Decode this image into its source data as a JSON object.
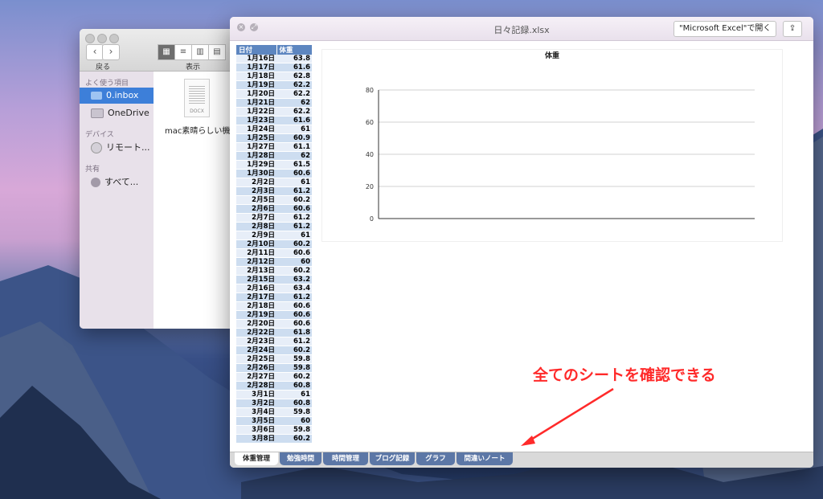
{
  "finder": {
    "back_label": "戻る",
    "view_label": "表示",
    "sections": {
      "favorites": "よく使う項目",
      "devices": "デバイス",
      "shared": "共有"
    },
    "sidebar_items": [
      "0.inbox",
      "OneDrive",
      "リモート...",
      "すべて..."
    ],
    "file": {
      "ext": "DOCX",
      "name": "mac素晴らしい機能"
    }
  },
  "quicklook": {
    "title": "日々記録.xlsx",
    "open_button": "\"Microsoft Excel\"で開く"
  },
  "sheet": {
    "headers": [
      "日付",
      "体重"
    ],
    "rows": [
      [
        "1月16日",
        "63.8"
      ],
      [
        "1月17日",
        "61.6"
      ],
      [
        "1月18日",
        "62.8"
      ],
      [
        "1月19日",
        "62.2"
      ],
      [
        "1月20日",
        "62.2"
      ],
      [
        "1月21日",
        "62"
      ],
      [
        "1月22日",
        "62.2"
      ],
      [
        "1月23日",
        "61.6"
      ],
      [
        "1月24日",
        "61"
      ],
      [
        "1月25日",
        "60.9"
      ],
      [
        "1月27日",
        "61.1"
      ],
      [
        "1月28日",
        "62"
      ],
      [
        "1月29日",
        "61.5"
      ],
      [
        "1月30日",
        "60.6"
      ],
      [
        "2月2日",
        "61"
      ],
      [
        "2月3日",
        "61.2"
      ],
      [
        "2月5日",
        "60.2"
      ],
      [
        "2月6日",
        "60.6"
      ],
      [
        "2月7日",
        "61.2"
      ],
      [
        "2月8日",
        "61.2"
      ],
      [
        "2月9日",
        "61"
      ],
      [
        "2月10日",
        "60.2"
      ],
      [
        "2月11日",
        "60.6"
      ],
      [
        "2月12日",
        "60"
      ],
      [
        "2月13日",
        "60.2"
      ],
      [
        "2月15日",
        "63.2"
      ],
      [
        "2月16日",
        "63.4"
      ],
      [
        "2月17日",
        "61.2"
      ],
      [
        "2月18日",
        "60.6"
      ],
      [
        "2月19日",
        "60.6"
      ],
      [
        "2月20日",
        "60.6"
      ],
      [
        "2月22日",
        "61.8"
      ],
      [
        "2月23日",
        "61.2"
      ],
      [
        "2月24日",
        "60.2"
      ],
      [
        "2月25日",
        "59.8"
      ],
      [
        "2月26日",
        "59.8"
      ],
      [
        "2月27日",
        "60.2"
      ],
      [
        "2月28日",
        "60.8"
      ],
      [
        "3月1日",
        "61"
      ],
      [
        "3月2日",
        "60.8"
      ],
      [
        "3月4日",
        "59.8"
      ],
      [
        "3月5日",
        "60"
      ],
      [
        "3月6日",
        "59.8"
      ],
      [
        "3月8日",
        "60.2"
      ]
    ]
  },
  "chart_data": {
    "type": "line",
    "title": "体重",
    "xlabel": "",
    "ylabel": "",
    "ylim": [
      0,
      80
    ],
    "yticks": [
      "0",
      "20",
      "40",
      "60",
      "80"
    ],
    "grid": true,
    "series": [
      {
        "values": []
      }
    ]
  },
  "tabs": [
    "体重管理",
    "勉強時間",
    "時間管理",
    "ブログ記録",
    "グラフ",
    "間違いノート"
  ],
  "annotation": "全てのシートを確認できる",
  "colors": {
    "accent": "#3d7fd9",
    "header": "#5d86c0",
    "tab": "#5c77a6",
    "annotation": "#ff2a2a"
  }
}
